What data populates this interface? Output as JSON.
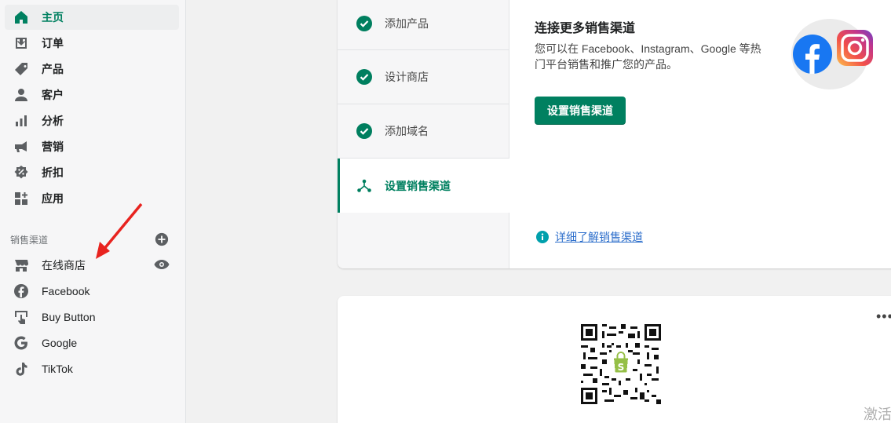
{
  "sidebar": {
    "items": [
      {
        "label": "主页",
        "icon": "home-icon"
      },
      {
        "label": "订单",
        "icon": "orders-icon"
      },
      {
        "label": "产品",
        "icon": "tag-icon"
      },
      {
        "label": "客户",
        "icon": "person-icon"
      },
      {
        "label": "分析",
        "icon": "bar-chart-icon"
      },
      {
        "label": "营销",
        "icon": "megaphone-icon"
      },
      {
        "label": "折扣",
        "icon": "discount-icon"
      },
      {
        "label": "应用",
        "icon": "apps-icon"
      }
    ],
    "channels_title": "销售渠道",
    "channels": [
      {
        "label": "在线商店",
        "icon": "store-icon"
      },
      {
        "label": "Facebook",
        "icon": "facebook-icon"
      },
      {
        "label": "Buy Button",
        "icon": "buy-button-icon"
      },
      {
        "label": "Google",
        "icon": "google-icon"
      },
      {
        "label": "TikTok",
        "icon": "tiktok-icon"
      }
    ]
  },
  "setup": {
    "steps": [
      {
        "label": "添加产品",
        "done": true
      },
      {
        "label": "设计商店",
        "done": true
      },
      {
        "label": "添加域名",
        "done": true
      },
      {
        "label": "设置销售渠道",
        "done": false,
        "active": true
      }
    ],
    "detail": {
      "title": "连接更多销售渠道",
      "description": "您可以在 Facebook、Instagram、Google 等热门平台销售和推广您的产品。",
      "button": "设置销售渠道",
      "learn_more": "详细了解销售渠道"
    }
  },
  "qr_card": {
    "more": "•••"
  },
  "watermark": "激活",
  "colors": {
    "accent": "#008060",
    "link": "#2c6ecb",
    "arrow": "#e8231f"
  }
}
